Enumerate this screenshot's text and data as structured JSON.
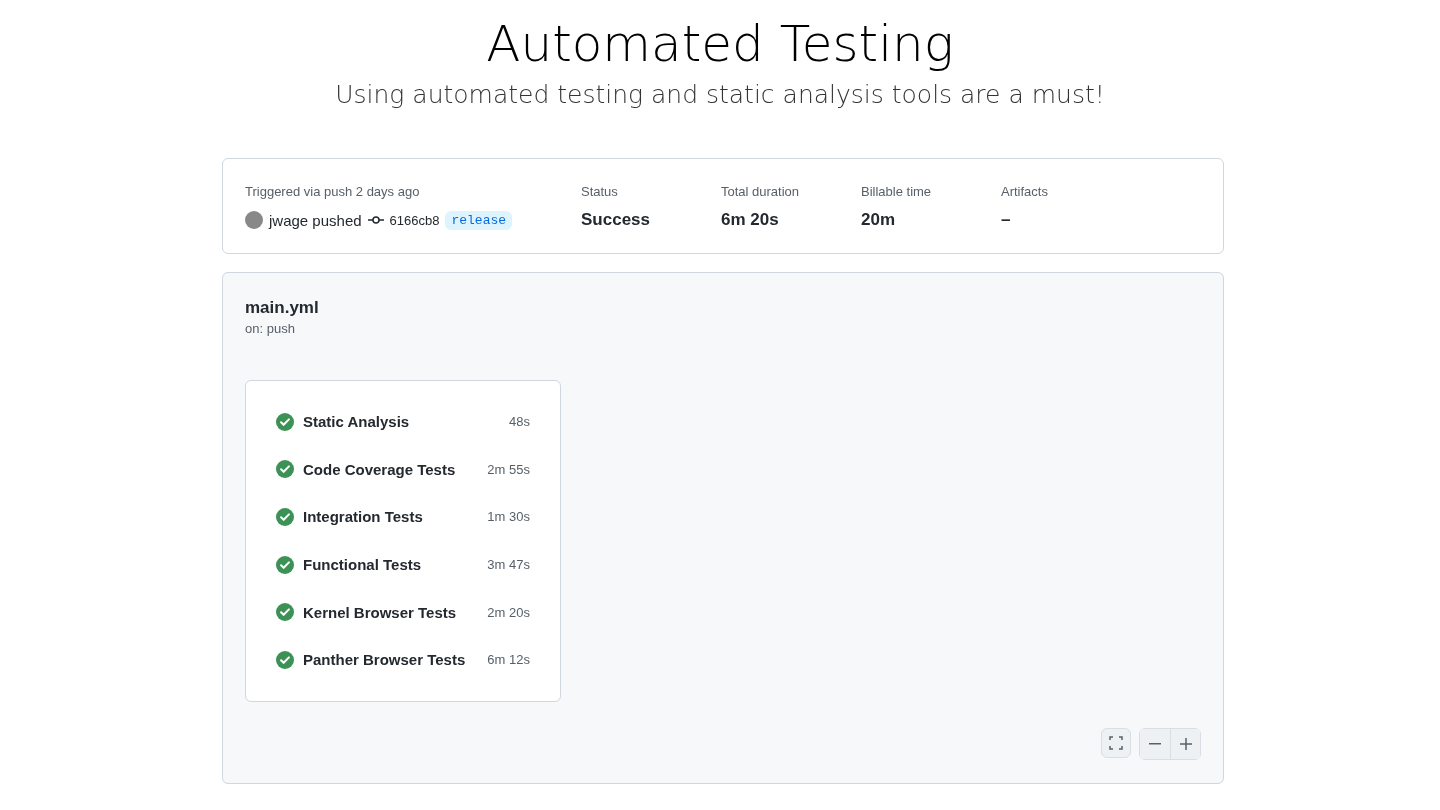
{
  "slide": {
    "title": "Automated Testing",
    "subtitle": "Using automated testing and static analysis tools are a must!"
  },
  "summary": {
    "trigger": "Triggered via push 2 days ago",
    "actor": "jwage",
    "action": "pushed",
    "commit": "6166cb8",
    "branch": "release",
    "stats": [
      {
        "label": "Status",
        "value": "Success"
      },
      {
        "label": "Total duration",
        "value": "6m 20s"
      },
      {
        "label": "Billable time",
        "value": "20m"
      },
      {
        "label": "Artifacts",
        "value": "–"
      }
    ]
  },
  "workflow": {
    "name": "main.yml",
    "trigger": "on: push",
    "jobs": [
      {
        "name": "Static Analysis",
        "duration": "48s",
        "kind": "success"
      },
      {
        "name": "Code Coverage Tests",
        "duration": "2m 55s",
        "kind": "success"
      },
      {
        "name": "Integration Tests",
        "duration": "1m 30s",
        "kind": "success"
      },
      {
        "name": "Functional Tests",
        "duration": "3m 47s",
        "kind": "success"
      },
      {
        "name": "Kernel Browser Tests",
        "duration": "2m 20s",
        "kind": "success"
      },
      {
        "name": "Panther Browser Tests",
        "duration": "6m 12s",
        "kind": "success"
      }
    ]
  }
}
